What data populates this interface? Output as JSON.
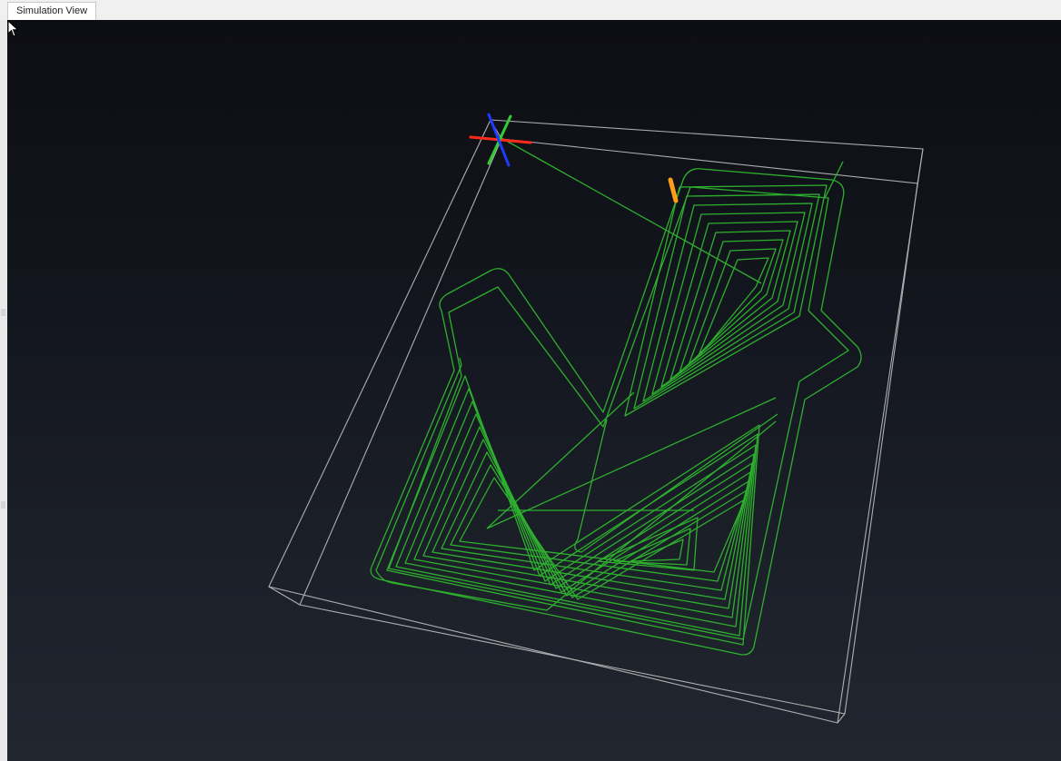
{
  "window": {
    "tab_label": "Simulation View"
  },
  "scene": {
    "background_top": "#0d0e13",
    "background_bottom": "#22262f",
    "stock_outline_color": "#c8c8c8",
    "toolpath_color": "#2fb82f",
    "axis_x_color": "#ff2a1a",
    "axis_y_color": "#33cc33",
    "axis_z_color": "#1f3bff",
    "tool_color": "#ff9d1a"
  }
}
